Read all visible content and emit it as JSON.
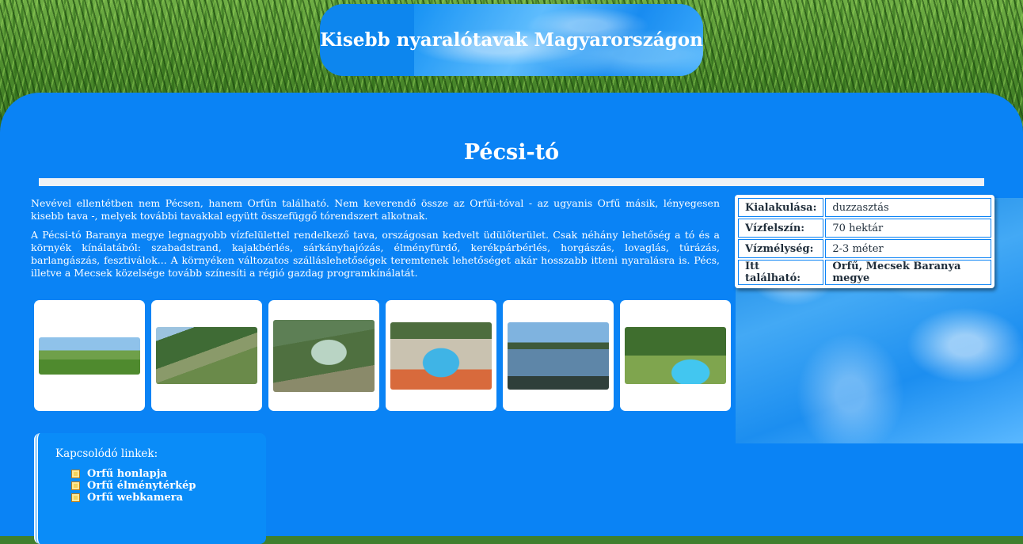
{
  "header": {
    "title": "Kisebb nyaralótavak Magyarországon"
  },
  "page": {
    "title": "Pécsi-tó",
    "paragraphs": [
      "Nevével ellentétben nem Pécsen, hanem Orfűn található. Nem keverendő össze az Orfűi-tóval - az ugyanis Orfű másik, lényegesen kisebb tava -, melyek további tavakkal együtt összefüggő tórendszert alkotnak.",
      "A Pécsi-tó Baranya megye legnagyobb vízfelülettel rendelkező tava, országosan kedvelt üdülőterület. Csak néhány lehetőség a tó és a környék kínálatából: szabadstrand, kajakbérlés, sárkányhajózás, élményfürdő, kerékpárbérlés, horgászás, lovaglás, túrázás, barlangászás, fesztiválok... A környéken változatos szálláslehetőségek teremtenek lehetőséget akár hosszabb itteni nyaralásra is. Pécs, illetve a Mecsek közelsége tovább színesíti a régió gazdag programkínálatát."
    ]
  },
  "gallery": [
    {
      "icon": "landscape-photo"
    },
    {
      "icon": "aerial-lake-photo"
    },
    {
      "icon": "aerial-village-photo"
    },
    {
      "icon": "waterpark-photo"
    },
    {
      "icon": "lake-pier-photo"
    },
    {
      "icon": "pool-garden-photo"
    }
  ],
  "facts": [
    {
      "key": "Kialakulása:",
      "value": "duzzasztás"
    },
    {
      "key": "Vízfelszín:",
      "value": "70 hektár"
    },
    {
      "key": "Vízmélység:",
      "value": "2-3 méter"
    },
    {
      "key": "Itt található:",
      "value": "Orfű, Mecsek Baranya megye"
    }
  ],
  "links": {
    "title": "Kapcsolódó linkek:",
    "items": [
      "Orfű honlapja",
      "Orfű élménytérkép",
      "Orfű webkamera"
    ]
  },
  "colors": {
    "main": "#0a83f5",
    "header": "#0d86ee",
    "grass": "#4c8a2c"
  }
}
